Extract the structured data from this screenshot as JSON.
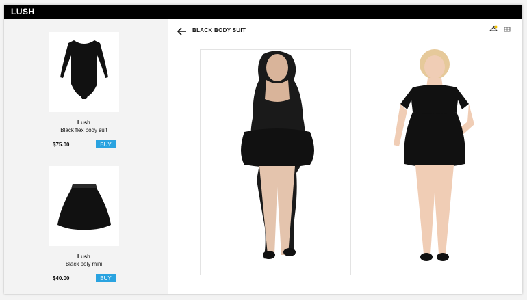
{
  "app": {
    "brand": "LUSH"
  },
  "sidebar": {
    "products": [
      {
        "brand": "Lush",
        "name": "Black flex body suit",
        "price": "$75.00",
        "buy_label": "BUY",
        "icon": "bodysuit-image"
      },
      {
        "brand": "Lush",
        "name": "Black poly mini",
        "price": "$40.00",
        "buy_label": "BUY",
        "icon": "skirt-image"
      }
    ]
  },
  "main": {
    "title": "BLACK BODY SUIT",
    "icons": [
      "back-arrow-icon",
      "hanger-icon",
      "gallery-icon"
    ]
  },
  "colors": {
    "topbar": "#000000",
    "buy_button": "#2aa3e0",
    "sidebar_bg": "#f3f3f3"
  }
}
